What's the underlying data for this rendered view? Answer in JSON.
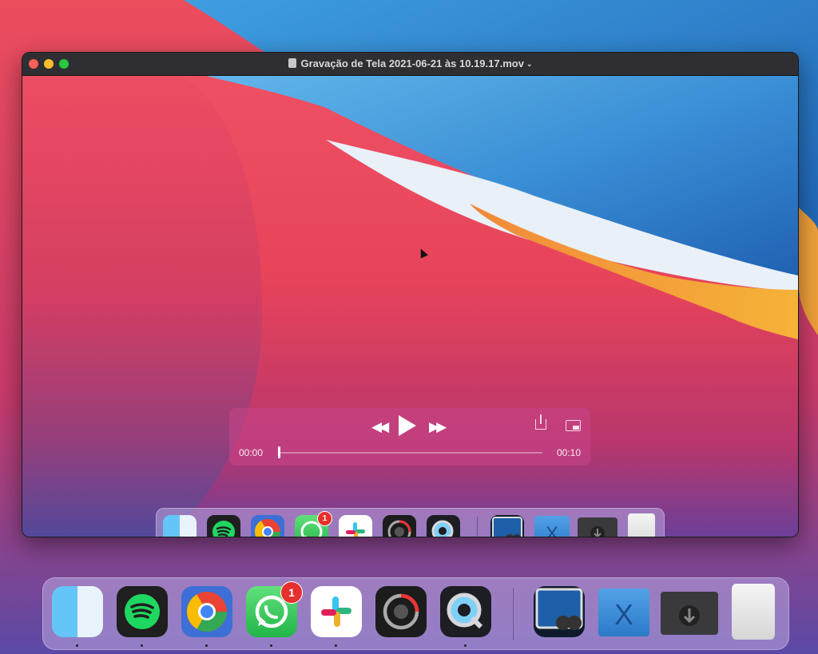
{
  "window": {
    "title": "Gravação de Tela 2021-06-21 às 10.19.17.mov"
  },
  "player": {
    "time_elapsed": "00:00",
    "time_total": "00:10",
    "progress": 0
  },
  "dock_apps": [
    {
      "name": "Finder",
      "icon": "finder-icon",
      "running": true
    },
    {
      "name": "Spotify",
      "icon": "spotify-icon",
      "running": true
    },
    {
      "name": "Google Chrome",
      "icon": "chrome-icon",
      "running": true
    },
    {
      "name": "WhatsApp",
      "icon": "whatsapp-icon",
      "running": true,
      "badge": "1"
    },
    {
      "name": "Slack",
      "icon": "slack-icon",
      "running": true
    },
    {
      "name": "Photo Booth",
      "icon": "photo-booth-icon",
      "running": false
    },
    {
      "name": "QuickTime Player",
      "icon": "quicktime-icon",
      "running": true
    }
  ],
  "dock_right": [
    {
      "name": "Preview",
      "icon": "preview-icon"
    },
    {
      "name": "Applications",
      "icon": "applications-folder-icon"
    },
    {
      "name": "Downloads",
      "icon": "downloads-stack-icon"
    },
    {
      "name": "Trash",
      "icon": "trash-icon"
    }
  ],
  "badges": {
    "whatsapp_small": "1",
    "whatsapp_big": "1"
  },
  "colors": {
    "accent_red": "#fe5f57",
    "accent_yellow": "#febc2e",
    "accent_green": "#28c840",
    "badge_red": "#e5302d"
  }
}
